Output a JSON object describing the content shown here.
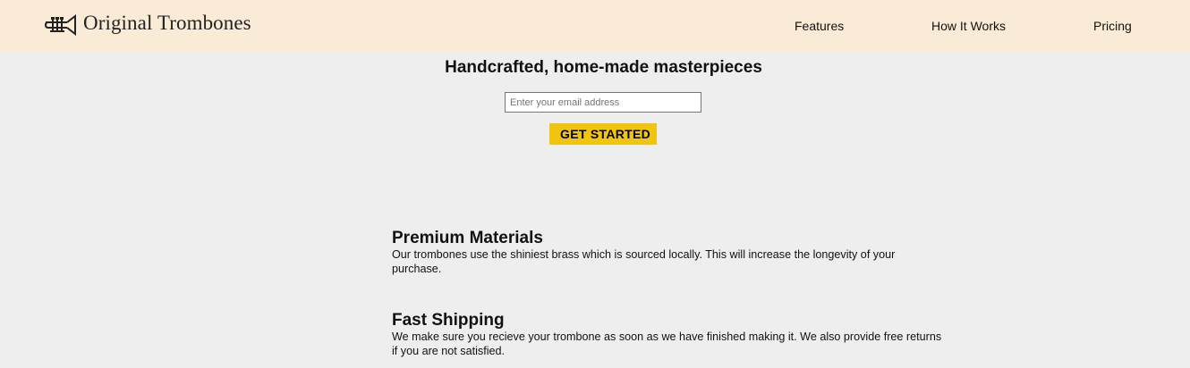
{
  "header": {
    "brand_name": "Original Trombones",
    "logo_icon": "trumpet-icon",
    "nav": [
      {
        "label": "Features"
      },
      {
        "label": "How It Works"
      },
      {
        "label": "Pricing"
      }
    ]
  },
  "hero": {
    "title": "Handcrafted, home-made masterpieces",
    "email_placeholder": "Enter your email address",
    "cta_label": "GET STARTED"
  },
  "features": [
    {
      "title": "Premium Materials",
      "text": "Our trombones use the shiniest brass which is sourced locally. This will increase the longevity of your purchase."
    },
    {
      "title": "Fast Shipping",
      "text": "We make sure you recieve your trombone as soon as we have finished making it. We also provide free returns if you are not satisfied."
    }
  ],
  "colors": {
    "header_bg": "#faebd7",
    "page_bg": "#eeeeee",
    "cta_bg": "#f1c40f"
  }
}
